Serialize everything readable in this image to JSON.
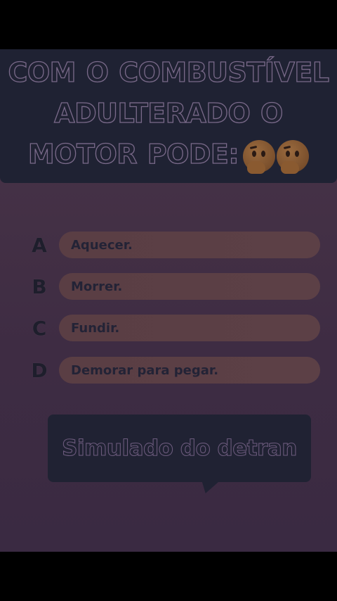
{
  "question": {
    "text": "COM O COMBUSTÍVEL ADULTERADO O MOTOR PODE:",
    "emojis": [
      "thinking-face-icon",
      "thinking-face-icon"
    ]
  },
  "options": [
    {
      "letter": "A",
      "text": "Aquecer."
    },
    {
      "letter": "B",
      "text": "Morrer."
    },
    {
      "letter": "C",
      "text": "Fundir."
    },
    {
      "letter": "D",
      "text": "Demorar para pegar."
    }
  ],
  "footer_bubble": {
    "text": "Simulado do detran"
  },
  "colors": {
    "background": "#3e2c43",
    "question_box": "#1f2233",
    "option_pill": "#5a3e44",
    "bubble": "#202233"
  }
}
